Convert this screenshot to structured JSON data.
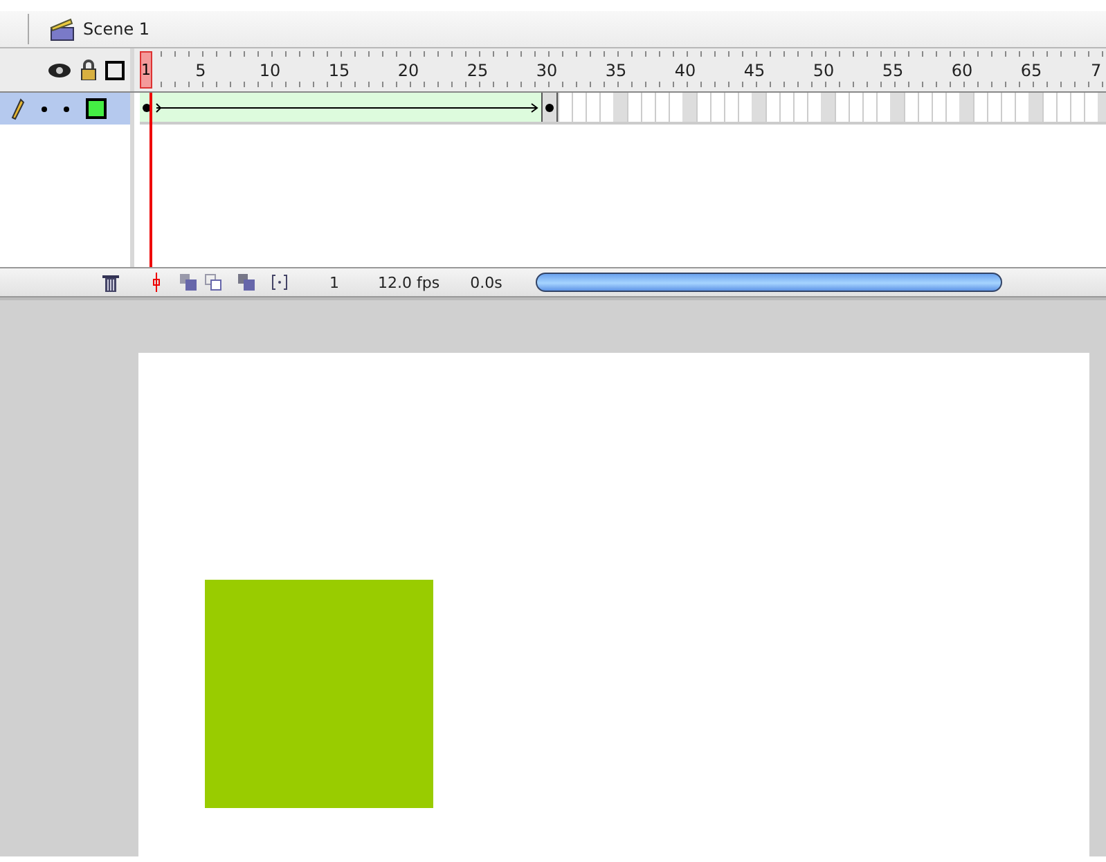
{
  "scene_bar": {
    "label": "Scene 1"
  },
  "timeline": {
    "playhead": {
      "label": "1"
    },
    "ruler_labels": [
      "5",
      "10",
      "15",
      "20",
      "25",
      "30",
      "35",
      "40",
      "45",
      "50",
      "55",
      "60",
      "65",
      "7"
    ],
    "layers": [
      {
        "selected": true,
        "visible": true,
        "locked": false,
        "color": "#44ee44",
        "segments": [
          {
            "kind": "motion-tween"
          },
          {
            "kind": "keyframe"
          },
          {
            "kind": "empty"
          }
        ]
      }
    ]
  },
  "status": {
    "current_frame": "1",
    "frame_rate": "12.0 fps",
    "elapsed": "0.0s"
  },
  "stage": {
    "shapes": [
      {
        "kind": "rectangle",
        "color": "#99cc00"
      }
    ]
  }
}
